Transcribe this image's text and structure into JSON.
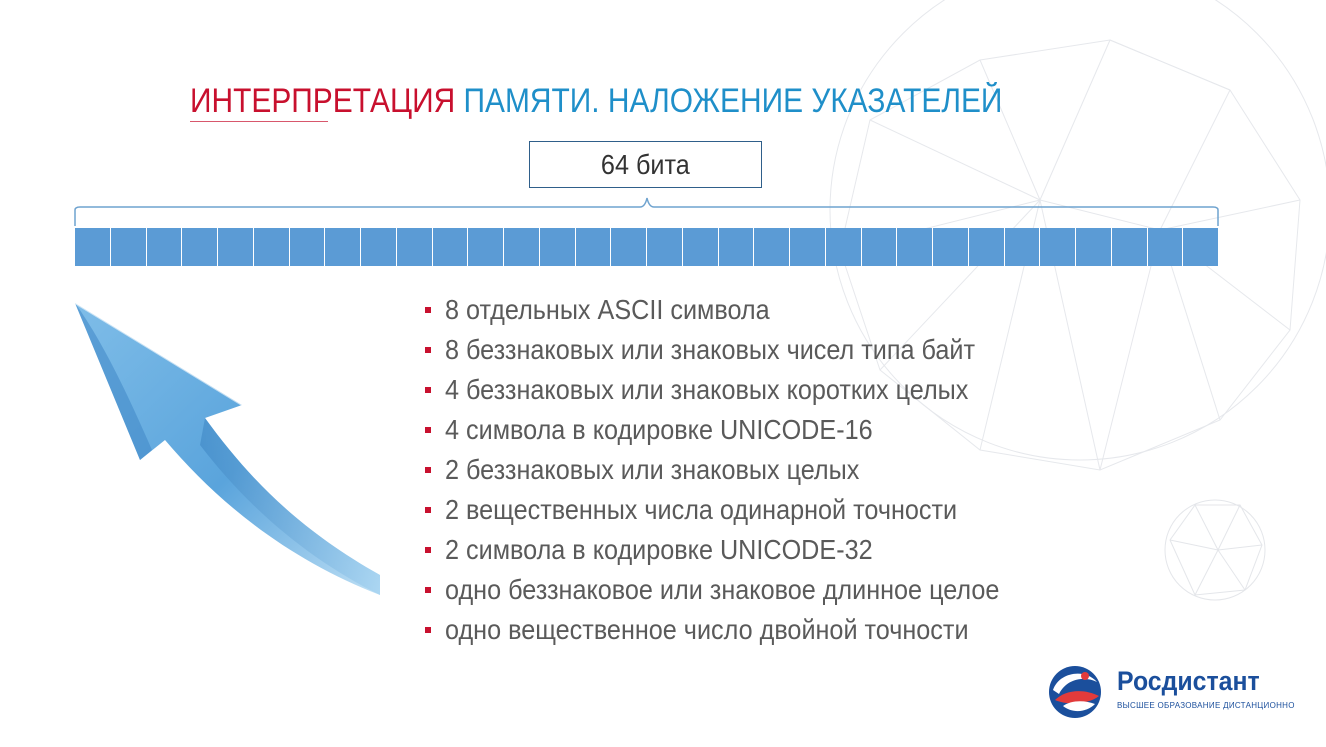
{
  "slide": {
    "title_part1": "ИНТЕРПРЕТАЦИЯ",
    "title_part2": "ПАМЯТИ. НАЛОЖЕНИЕ УКАЗАТЕЛЕЙ",
    "bits_label": "64 бита",
    "items": [
      "8 отдельных ASCII символа",
      "8 беззнаковых или знаковых чисел типа байт",
      "4 беззнаковых или знаковых коротких целых",
      "4 символа в кодировке UNICODE-16",
      "2 беззнаковых или знаковых целых",
      "2 вещественных числа одинарной точности",
      "2 символа в кодировке UNICODE-32",
      "одно беззнаковое или знаковое длинное целое",
      "одно вещественное число двойной точности"
    ]
  },
  "logo": {
    "name": "Росдистант",
    "tagline": "ВЫСШЕЕ ОБРАЗОВАНИЕ ДИСТАНЦИОННО"
  },
  "colors": {
    "title_red": "#c8102e",
    "title_blue": "#1f8fc9",
    "cell_blue": "#5b9bd5",
    "bullet_red": "#c8102e",
    "logo_blue": "#1b4f9c"
  }
}
